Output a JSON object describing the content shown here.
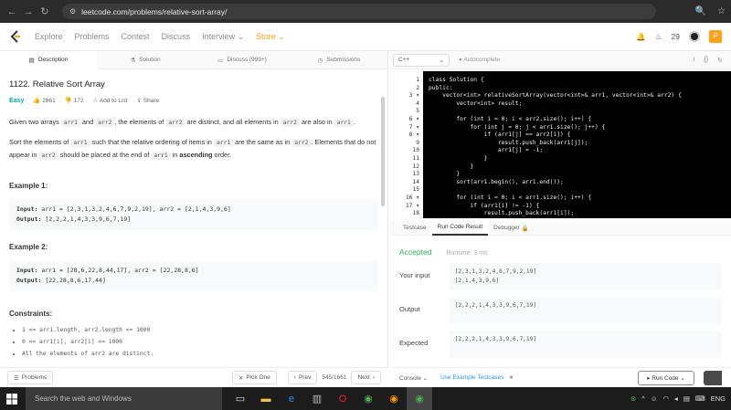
{
  "browser": {
    "url": "leetcode.com/problems/relative-sort-array/"
  },
  "nav": {
    "items": [
      "Explore",
      "Problems",
      "Contest",
      "Discuss",
      "Interview ⌄",
      "Store ⌄"
    ],
    "coins": "29",
    "premium": "P"
  },
  "left_tabs": [
    "Description",
    "Solution",
    "Discuss (999+)",
    "Submissions"
  ],
  "problem": {
    "title": "1122. Relative Sort Array",
    "difficulty": "Easy",
    "likes": "2861",
    "dislikes": "172",
    "add_to_list": "Add to List",
    "share": "Share",
    "p1": [
      "Given two arrays ",
      "arr1",
      " and ",
      "arr2",
      ", the elements of ",
      "arr2",
      " are distinct, and all elements in ",
      "arr2",
      " are also in ",
      "arr1",
      "."
    ],
    "p2": [
      "Sort the elements of ",
      "arr1",
      " such that the relative ordering of items in ",
      "arr1",
      " are the same as in ",
      "arr2",
      ". Elements that do not appear in ",
      "arr2",
      " should be placed at the end of ",
      "arr1",
      " in ",
      "ascending",
      " order."
    ],
    "ex1_title": "Example 1:",
    "ex1_input": "arr1 = [2,3,1,3,2,4,6,7,9,2,19], arr2 = [2,1,4,3,9,6]",
    "ex1_output": "[2,2,2,1,4,3,3,9,6,7,19]",
    "ex2_title": "Example 2:",
    "ex2_input": "arr1 = [28,6,22,8,44,17], arr2 = [22,28,8,6]",
    "ex2_output": "[22,28,8,6,17,44]",
    "input_label": "Input:",
    "output_label": "Output:",
    "constraints_title": "Constraints:",
    "constraints": [
      "1 <= arr1.length, arr2.length <= 1000",
      "0 <= arr1[i], arr2[i] <= 1000",
      "All the elements of arr2 are distinct."
    ]
  },
  "left_bottom": {
    "problems": "Problems",
    "pick_one": "Pick One",
    "prev": "Prev",
    "page": "545/1661",
    "next": "Next"
  },
  "editor": {
    "language": "C++",
    "autocomplete": "Autocomplete"
  },
  "code_lines": [
    "class Solution {",
    "public:",
    "    vector<int> relativeSortArray(vector<int>& arr1, vector<int>& arr2) {",
    "        vector<int> result;",
    "",
    "        for (int i = 0; i < arr2.size(); i++) {",
    "            for (int j = 0; j < arr1.size(); j++) {",
    "                if (arr1[j] == arr2[i]) {",
    "                    result.push_back(arr1[j]);",
    "                    arr1[j] = -1;",
    "                }",
    "            }",
    "        }",
    "        sort(arr1.begin(), arr1.end());",
    "",
    "        for (int i = 0; i < arr1.size(); i++) {",
    "            if (arr1[i] != -1) {",
    "                result.push_back(arr1[i]);"
  ],
  "bottom_tabs": [
    "Testcase",
    "Run Code Result",
    "Debugger"
  ],
  "result": {
    "status": "Accepted",
    "runtime": "Runtime: 3 ms",
    "your_input_label": "Your input",
    "your_input": [
      "[2,3,1,3,2,4,6,7,9,2,19]",
      "[2,1,4,3,9,6]"
    ],
    "output_label": "Output",
    "output": "[2,2,2,1,4,3,3,9,6,7,19]",
    "expected_label": "Expected",
    "expected": "[2,2,2,1,4,3,3,9,6,7,19]"
  },
  "bottom_bar": {
    "console": "Console ⌄",
    "use_example": "Use Example Testcases",
    "run_code": "Run Code ⌄"
  },
  "taskbar": {
    "search": "Search the web and Windows",
    "lang": "ENG"
  }
}
